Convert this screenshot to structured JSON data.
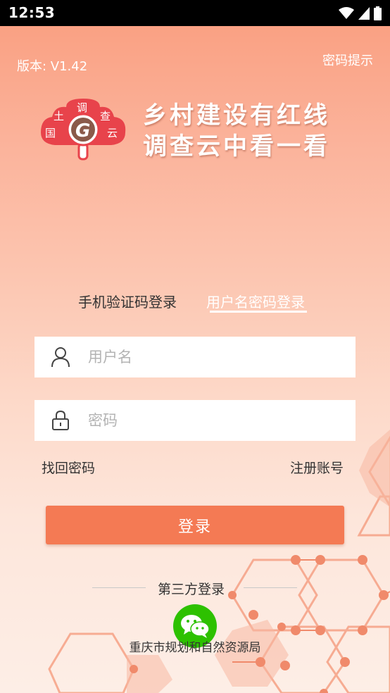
{
  "status_bar": {
    "time": "12:53"
  },
  "header": {
    "version": "版本: V1.42",
    "password_hint": "密码提示"
  },
  "logo": {
    "chars": [
      "土",
      "调",
      "查",
      "国",
      "G",
      "云"
    ]
  },
  "slogan": {
    "line1": "乡村建设有红线",
    "line2": "调查云中看一看"
  },
  "tabs": [
    {
      "label": "手机验证码登录",
      "active": false
    },
    {
      "label": "用户名密码登录",
      "active": true
    }
  ],
  "form": {
    "username": {
      "placeholder": "用户名",
      "value": ""
    },
    "password": {
      "placeholder": "密码",
      "value": ""
    }
  },
  "links": {
    "forgot": "找回密码",
    "register": "注册账号"
  },
  "login_button": "登录",
  "third_party": {
    "label": "第三方登录",
    "providers": [
      "wechat-icon"
    ]
  },
  "footer": "重庆市规划和自然资源局",
  "colors": {
    "accent": "#f47a54",
    "wechat": "#2dc100"
  }
}
